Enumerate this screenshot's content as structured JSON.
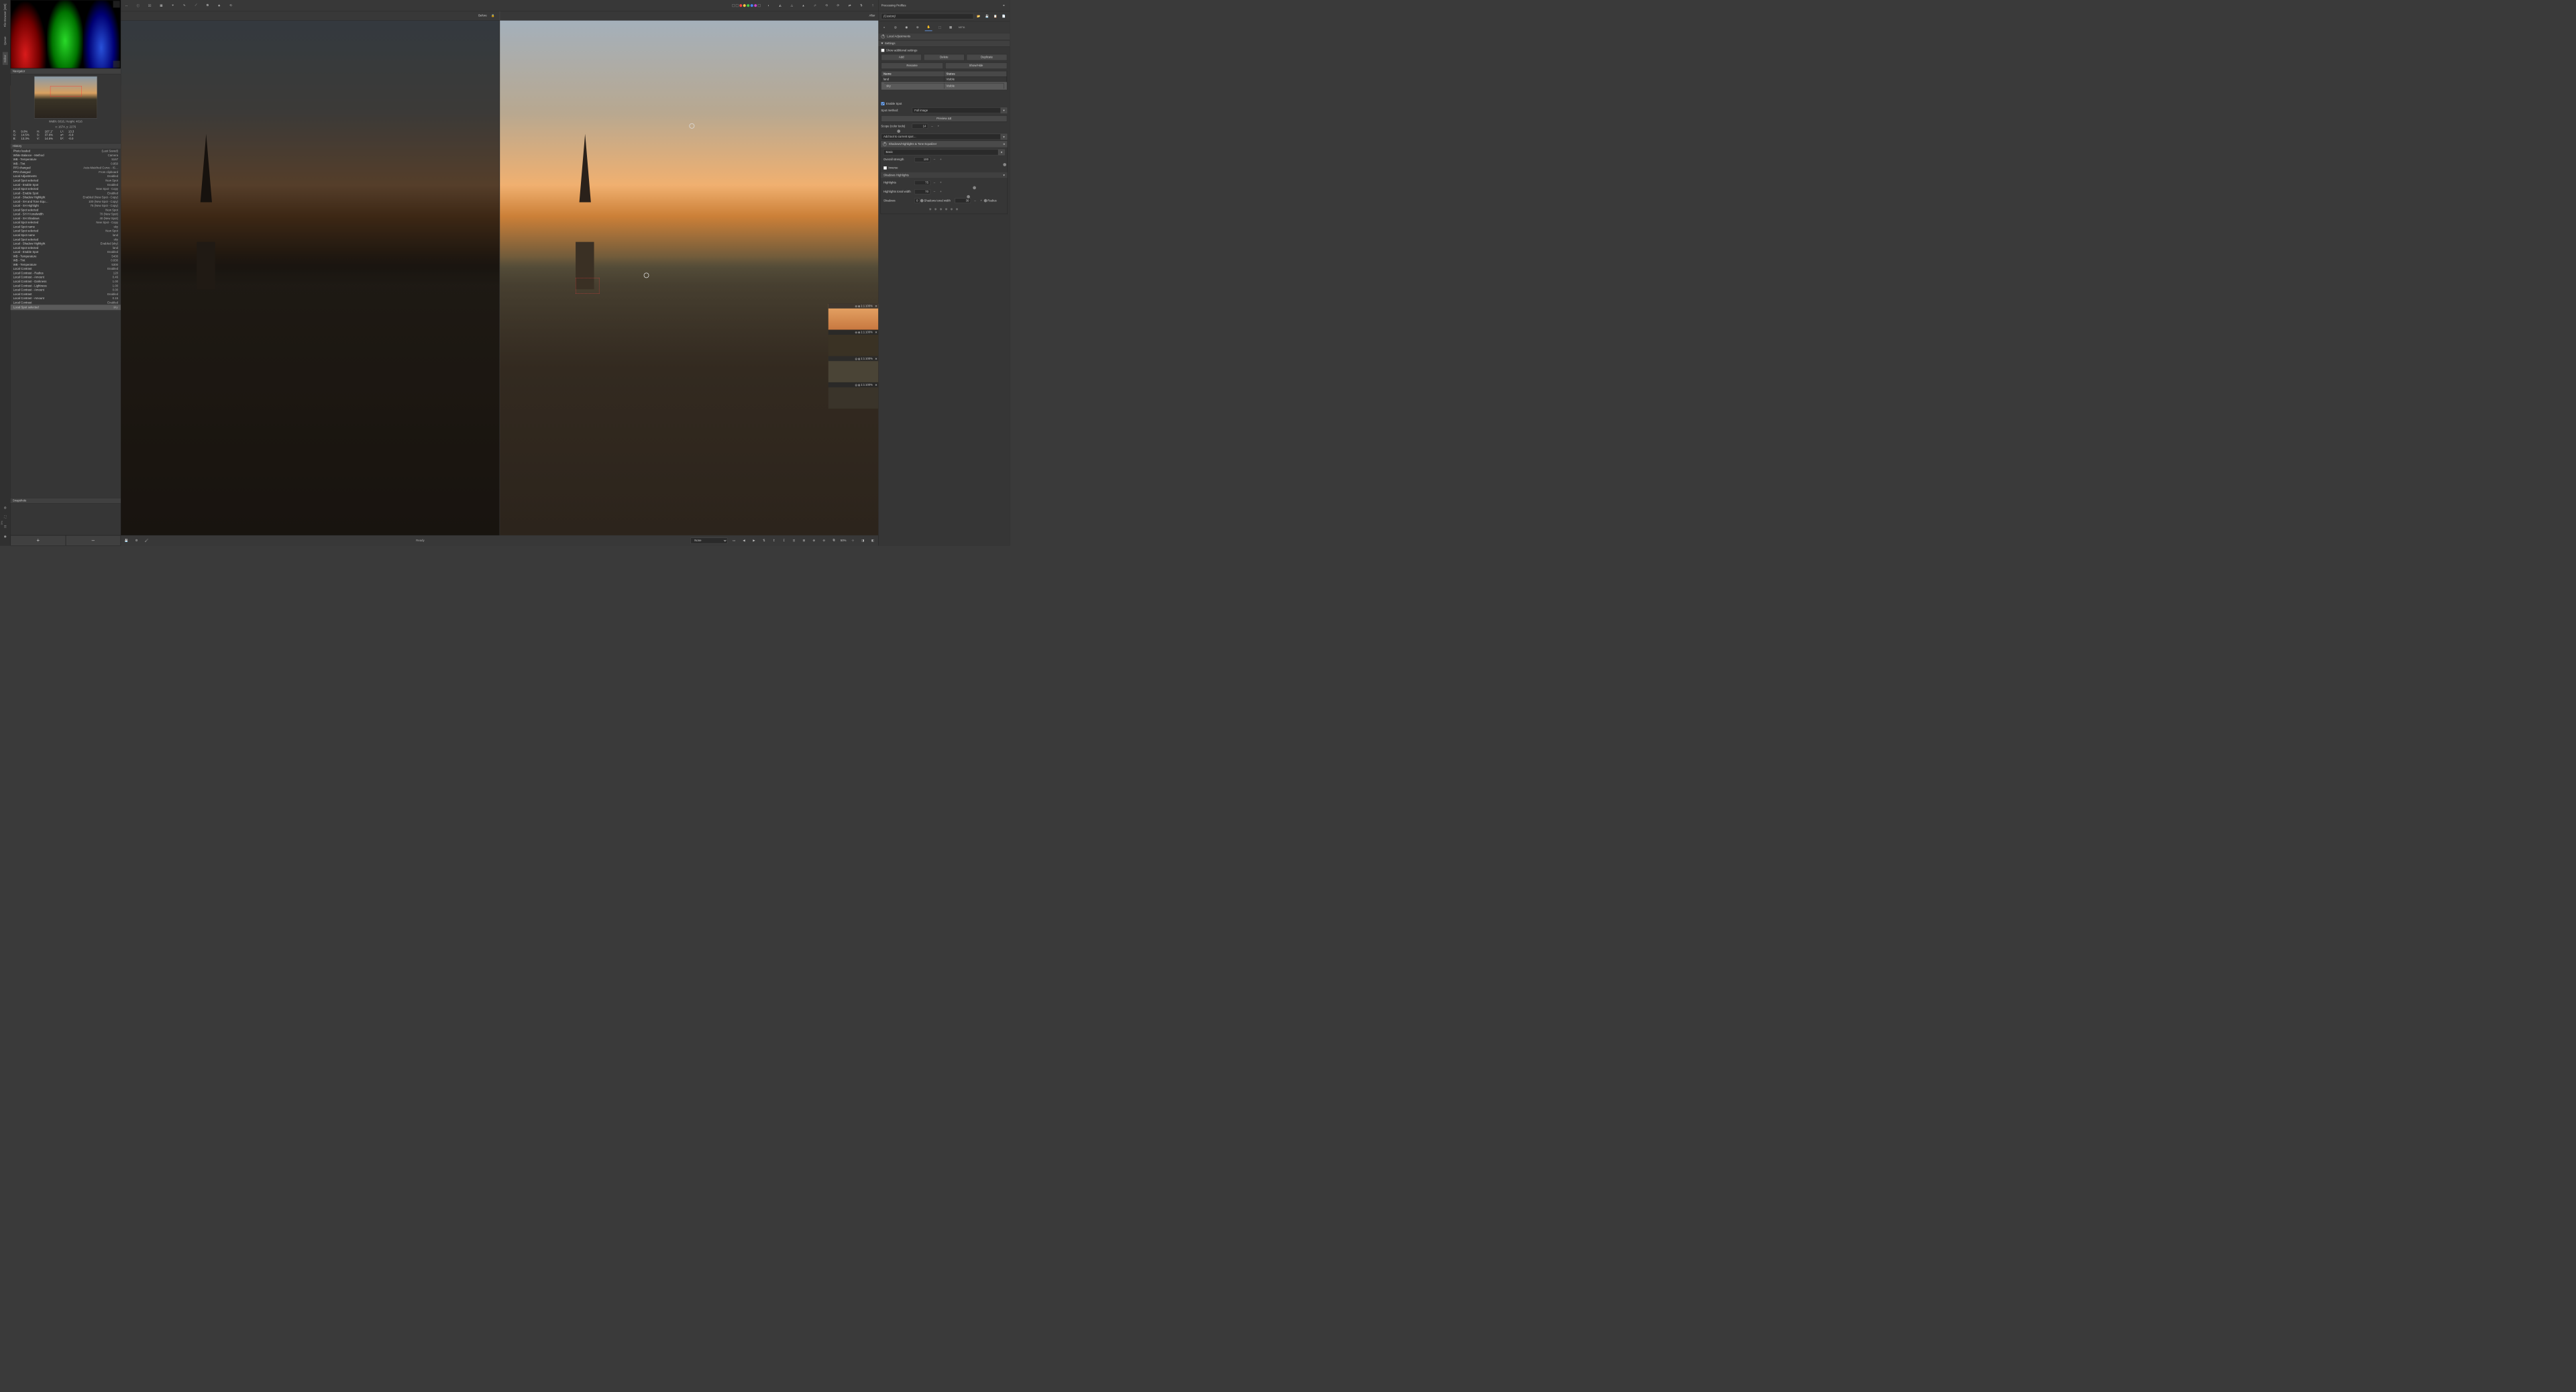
{
  "rail": {
    "tabs": [
      "File Browser [309]",
      "Queue",
      "Editor"
    ]
  },
  "toolbar_top": {
    "icons": [
      "arrow-cursor",
      "info",
      "copy",
      "layers",
      "picker",
      "wb-picker",
      "crop",
      "straighten",
      "perspective"
    ],
    "right_icons": [
      "gamut",
      "histogram-warn",
      "highlight-clip",
      "shadow-clip",
      "curve",
      "rotate-ccw",
      "rotate-cw",
      "flip-h",
      "flip-v",
      "sort"
    ]
  },
  "before_after": {
    "before": "Before",
    "after": "After"
  },
  "navigator": {
    "title": "Navigator",
    "dim": "Width: 6016, Height: 4016",
    "pos": "x: 1674, y: 2276",
    "read": {
      "R": "9.0%",
      "H": "167.1°",
      "L*": "13.3",
      "G": "14.5%",
      "S": "37.8%",
      "a*": "-6.9",
      "B": "13.3%",
      "V": "14.5%",
      "b*": "-0.0"
    }
  },
  "history": {
    "title": "History",
    "rows": [
      [
        "Photo loaded",
        "(Last Saved)"
      ],
      [
        "White Balance - Method",
        "Camera"
      ],
      [
        "WB - Temperature",
        "5167"
      ],
      [
        "WB - Tint",
        "0.850"
      ],
      [
        "PP3 changed",
        "Auto-Matched Curve - IS…"
      ],
      [
        "PP3 changed",
        "From clipboard"
      ],
      [
        "Local Adjustments",
        "Enabled"
      ],
      [
        "Local Spot selected",
        "New Spot"
      ],
      [
        "Local - Enable Spot",
        "Enabled"
      ],
      [
        "Local Spot selected",
        "New Spot - Copy"
      ],
      [
        "Local - Enable Spot",
        "Enabled"
      ],
      [
        "Local - Shadow Highlight",
        "Enabled (New Spot - Copy)"
      ],
      [
        "Local - SH and Tone Equ…",
        "100 (New Spot - Copy)"
      ],
      [
        "Local - SH Highlight",
        "75 (New Spot - Copy)"
      ],
      [
        "Local Spot selected",
        "New Spot"
      ],
      [
        "Local - SH H tonalwidth",
        "70 (New Spot)"
      ],
      [
        "Local - SH Shadows",
        "40 (New Spot)"
      ],
      [
        "Local Spot selected",
        "New Spot - Copy"
      ],
      [
        "Local Spot name",
        "sky"
      ],
      [
        "Local Spot selected",
        "New Spot"
      ],
      [
        "Local Spot name",
        "land"
      ],
      [
        "Local Spot selected",
        "sky"
      ],
      [
        "Local - Shadow Highlight",
        "Enabled (sky)"
      ],
      [
        "Local Spot selected",
        "land"
      ],
      [
        "Local - Enable Spot",
        "Enabled"
      ],
      [
        "WB - Temperature",
        "5400"
      ],
      [
        "WB - Tint",
        "0.830"
      ],
      [
        "WB - Temperature",
        "5300"
      ],
      [
        "Local Contrast",
        "Enabled"
      ],
      [
        "Local Contrast - Radius",
        "120"
      ],
      [
        "Local Contrast - Amount",
        "0.46"
      ],
      [
        "Local Contrast - Darkness",
        "1.00"
      ],
      [
        "Local Contrast - Lightness",
        "1.00"
      ],
      [
        "Local Contrast - Amount",
        "0.00"
      ],
      [
        "Local Contrast",
        "Enabled"
      ],
      [
        "Local Contrast - Amount",
        "0.15"
      ],
      [
        "Local Contrast",
        "Enabled"
      ],
      [
        "Local Spot selected",
        "sky"
      ]
    ],
    "selected_index": 37
  },
  "snapshots": {
    "title": "Snapshots",
    "add": "+",
    "del": "–"
  },
  "bottom": {
    "ready": "Ready",
    "progress": "0%",
    "bg_select": "None",
    "zoom": "50%"
  },
  "profiles": {
    "title": "Processing Profiles",
    "current": "(Custom)"
  },
  "local_adj": {
    "title": "Local Adjustments",
    "settings": "Settings",
    "show_additional": "Show additional settings",
    "btn_add": "Add",
    "btn_delete": "Delete",
    "btn_duplicate": "Duplicate",
    "btn_rename": "Rename",
    "btn_showhide": "Show/Hide",
    "col_name": "Name",
    "col_status": "Status",
    "spots": [
      {
        "name": "land",
        "status": "Visible"
      },
      {
        "name": "sky",
        "status": "Visible"
      }
    ],
    "selected_spot": 1,
    "enable_spot": "Enable Spot",
    "spot_method": "Spot method:",
    "spot_method_val": "Full image",
    "preview_de": "Preview ΔE",
    "scope": "Scope (color tools)",
    "scope_val": "14",
    "add_tool": "Add tool to current spot…"
  },
  "shtool": {
    "title": "Shadows/Highlights & Tone Equalizer",
    "mode": "Basic",
    "overall": "Overall strength",
    "overall_val": "100",
    "inverse": "Inverse",
    "sh_hdr": "Shadows Highlights",
    "highlights": "Highlights",
    "highlights_val": "75",
    "hl_tw": "Highlights tonal width",
    "hl_tw_val": "70",
    "shadows": "Shadows",
    "shadows_val": "0",
    "sh_tw": "Shadows tonal width",
    "sh_tw_val": "30",
    "radius": "Radius",
    "radius_val": "40"
  },
  "detail_zoom": "100%"
}
